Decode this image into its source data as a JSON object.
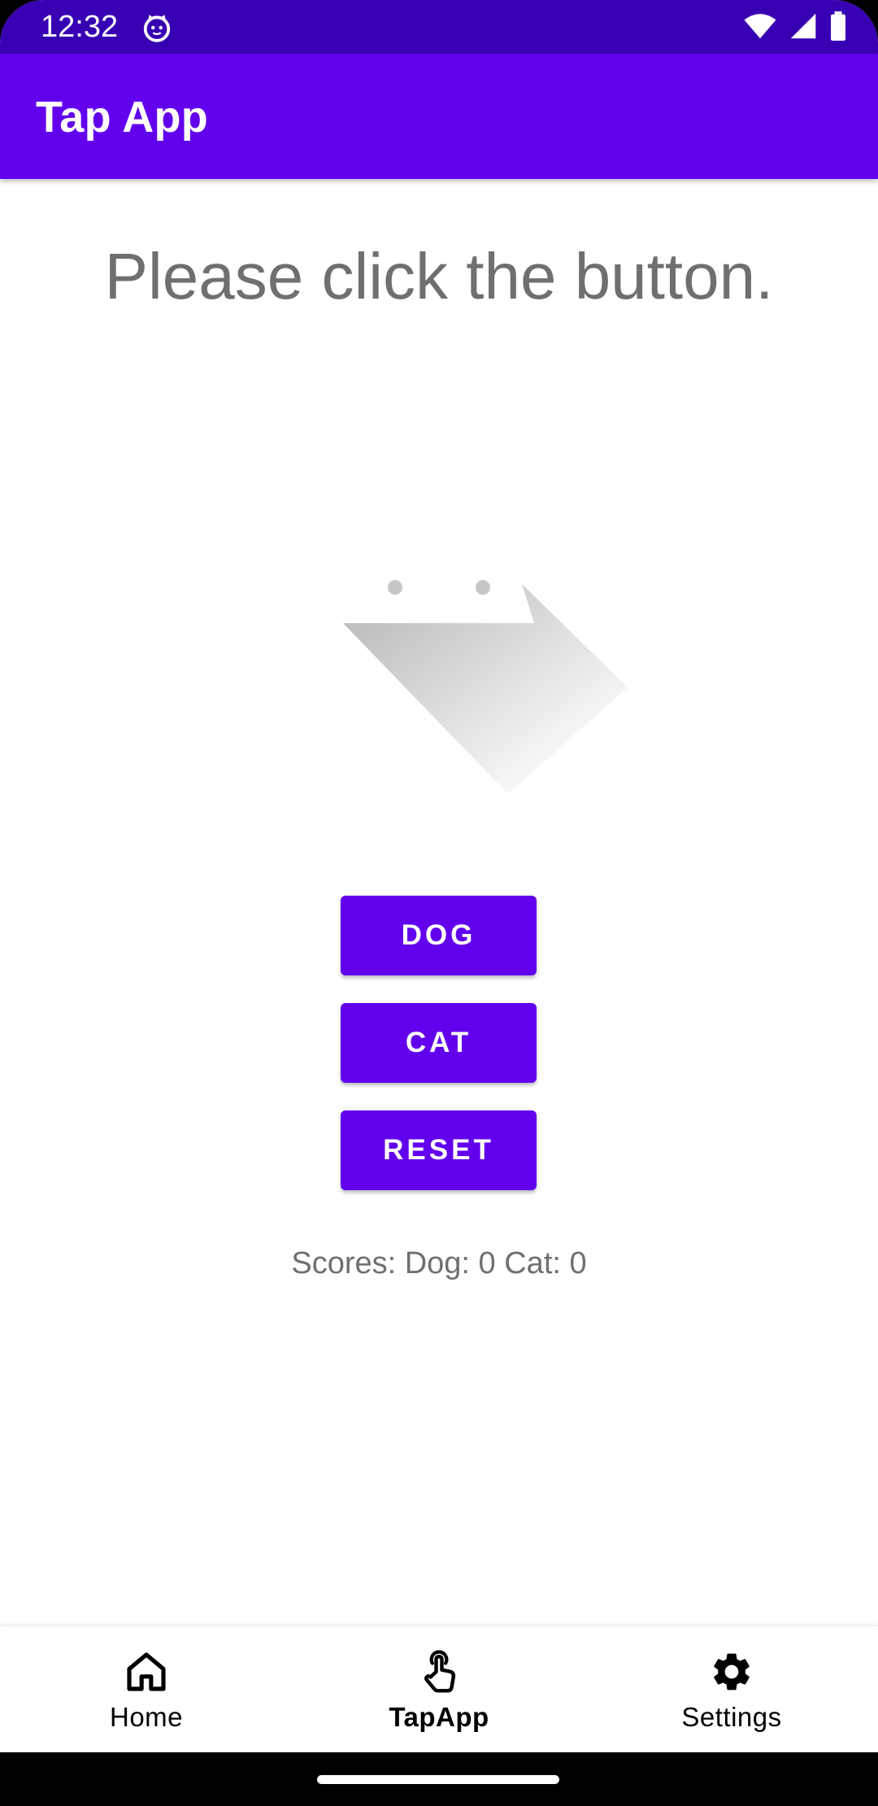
{
  "status_bar": {
    "time": "12:32",
    "icons": [
      "cat-notification-icon",
      "wifi-icon",
      "signal-icon",
      "battery-icon"
    ]
  },
  "app_bar": {
    "title": "Tap App"
  },
  "main": {
    "prompt": "Please click the button.",
    "buttons": {
      "dog": "DOG",
      "cat": "CAT",
      "reset": "RESET"
    },
    "scores": "Scores: Dog: 0 Cat: 0"
  },
  "bottom_nav": {
    "items": [
      {
        "label": "Home",
        "icon": "home-icon",
        "active": false
      },
      {
        "label": "TapApp",
        "icon": "touch-icon",
        "active": true
      },
      {
        "label": "Settings",
        "icon": "gear-icon",
        "active": false
      }
    ]
  },
  "colors": {
    "status_bar": "#3700b3",
    "primary": "#6200ee",
    "text_gray": "#6f6f6f"
  }
}
